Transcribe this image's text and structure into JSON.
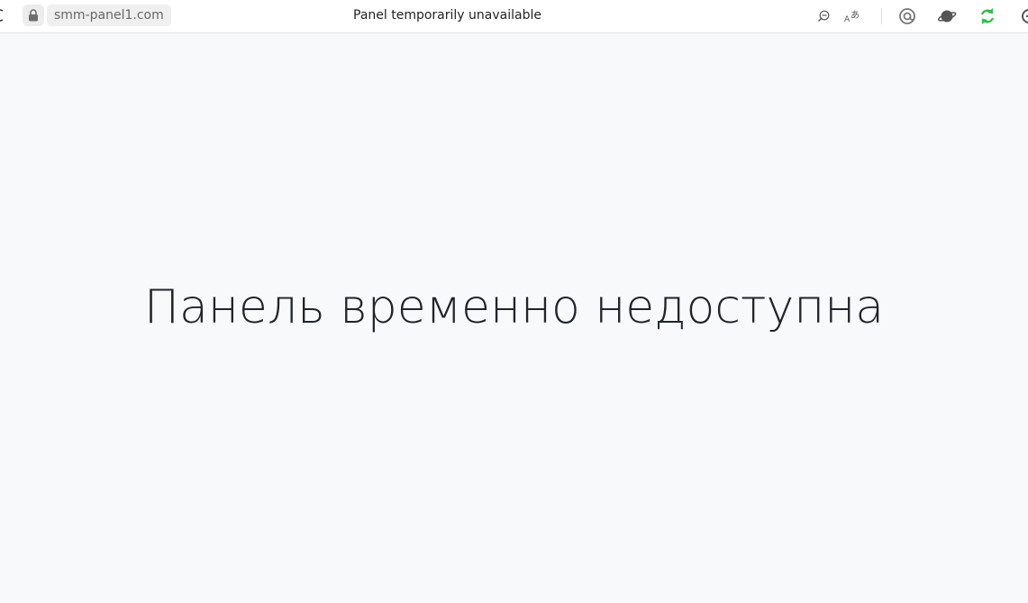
{
  "browser": {
    "address": {
      "url": "smm-panel1.com"
    },
    "tab_title": "Panel temporarily unavailable",
    "toolbar_icons": [
      "reload-icon",
      "lock-icon",
      "zoom-out-icon",
      "translate-icon",
      "extension-at-icon",
      "planet-icon",
      "sync-icon",
      "profile-icon"
    ],
    "colors": {
      "sync_icon": "#2fbf4a",
      "page_background": "#f8f9fa",
      "heading_text": "#212529"
    }
  },
  "page": {
    "heading": "Панель временно недоступна"
  }
}
